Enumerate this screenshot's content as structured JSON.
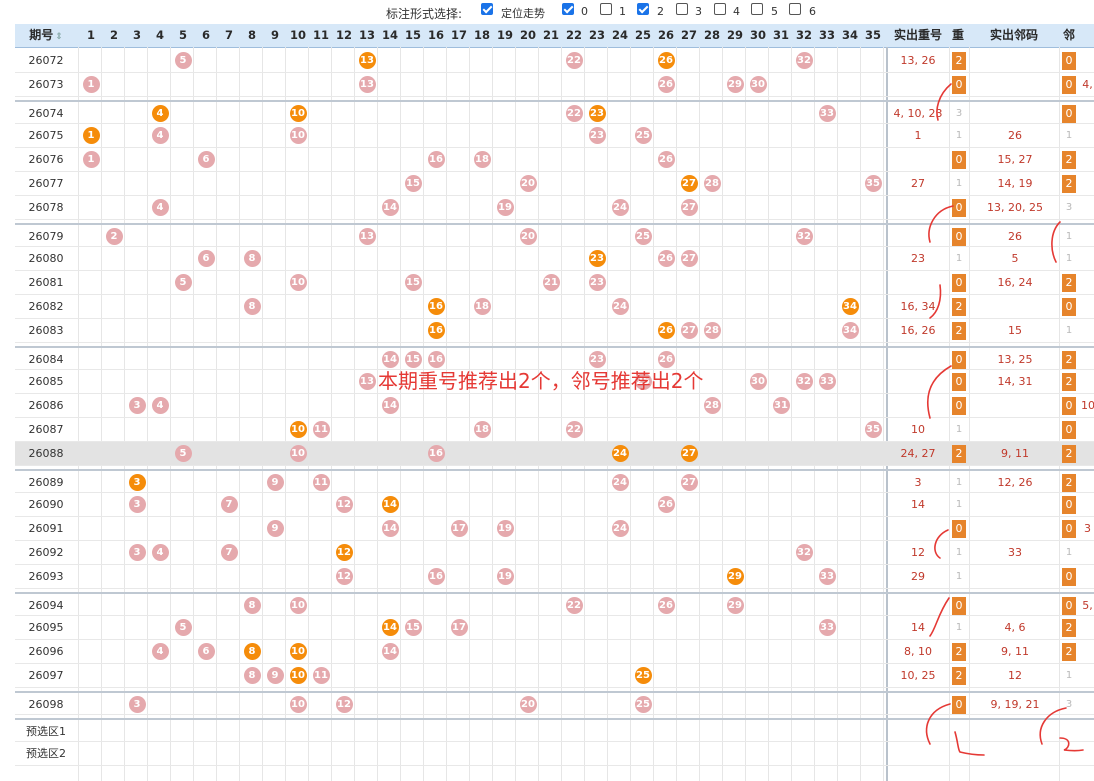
{
  "toolbar": {
    "label": "标注形式选择:",
    "options": [
      {
        "label": "定位走势",
        "checked": true
      },
      {
        "label": "0",
        "checked": true
      },
      {
        "label": "1",
        "checked": false
      },
      {
        "label": "2",
        "checked": true
      },
      {
        "label": "3",
        "checked": false
      },
      {
        "label": "4",
        "checked": false
      },
      {
        "label": "5",
        "checked": false
      },
      {
        "label": "6",
        "checked": false
      }
    ]
  },
  "header": {
    "period": "期号",
    "numbers": [
      "1",
      "2",
      "3",
      "4",
      "5",
      "6",
      "7",
      "8",
      "9",
      "10",
      "11",
      "12",
      "13",
      "14",
      "15",
      "16",
      "17",
      "18",
      "19",
      "20",
      "21",
      "22",
      "23",
      "24",
      "25",
      "26",
      "27",
      "28",
      "29",
      "30",
      "31",
      "32",
      "33",
      "34",
      "35"
    ],
    "repeat": "实出重号",
    "chong": "重",
    "neighbor": "实出邻码",
    "lin": "邻"
  },
  "annotation": "本期重号推荐出2个，邻号推荐出2个",
  "rows": [
    {
      "id": "26072",
      "balls": [
        {
          "n": 5,
          "c": "pink"
        },
        {
          "n": 13,
          "c": "orange"
        },
        {
          "n": 22,
          "c": "pink"
        },
        {
          "n": 26,
          "c": "orange"
        },
        {
          "n": 32,
          "c": "pink"
        }
      ],
      "rep": "13, 26",
      "c": "2",
      "nb": "",
      "l": "0"
    },
    {
      "id": "26073",
      "balls": [
        {
          "n": 1,
          "c": "pink"
        },
        {
          "n": 13,
          "c": "pink"
        },
        {
          "n": 26,
          "c": "pink"
        },
        {
          "n": 29,
          "c": "pink"
        },
        {
          "n": 30,
          "c": "pink"
        }
      ],
      "rep": "",
      "c": "0",
      "nb": "",
      "l": "0",
      "extra": "4,"
    },
    {
      "id": "26074",
      "grp": true,
      "balls": [
        {
          "n": 4,
          "c": "orange"
        },
        {
          "n": 10,
          "c": "orange"
        },
        {
          "n": 22,
          "c": "pink"
        },
        {
          "n": 23,
          "c": "orange"
        },
        {
          "n": 33,
          "c": "pink"
        }
      ],
      "rep": "4, 10, 23",
      "c": "3",
      "nb": "",
      "l": "0"
    },
    {
      "id": "26075",
      "balls": [
        {
          "n": 1,
          "c": "orange"
        },
        {
          "n": 4,
          "c": "pink"
        },
        {
          "n": 10,
          "c": "pink"
        },
        {
          "n": 23,
          "c": "pink"
        },
        {
          "n": 25,
          "c": "pink"
        }
      ],
      "rep": "1",
      "c": "1",
      "nb": "26",
      "l": "1"
    },
    {
      "id": "26076",
      "balls": [
        {
          "n": 1,
          "c": "pink"
        },
        {
          "n": 6,
          "c": "pink"
        },
        {
          "n": 16,
          "c": "pink"
        },
        {
          "n": 18,
          "c": "pink"
        },
        {
          "n": 26,
          "c": "pink"
        }
      ],
      "rep": "",
      "c": "0",
      "nb": "15, 27",
      "l": "2"
    },
    {
      "id": "26077",
      "balls": [
        {
          "n": 15,
          "c": "pink"
        },
        {
          "n": 20,
          "c": "pink"
        },
        {
          "n": 27,
          "c": "orange"
        },
        {
          "n": 28,
          "c": "pink"
        },
        {
          "n": 35,
          "c": "pink"
        }
      ],
      "rep": "27",
      "c": "1",
      "nb": "14, 19",
      "l": "2"
    },
    {
      "id": "26078",
      "balls": [
        {
          "n": 4,
          "c": "pink"
        },
        {
          "n": 14,
          "c": "pink"
        },
        {
          "n": 19,
          "c": "pink"
        },
        {
          "n": 24,
          "c": "pink"
        },
        {
          "n": 27,
          "c": "pink"
        }
      ],
      "rep": "",
      "c": "0",
      "nb": "13, 20, 25",
      "l": "3"
    },
    {
      "id": "26079",
      "grp": true,
      "balls": [
        {
          "n": 2,
          "c": "pink"
        },
        {
          "n": 13,
          "c": "pink"
        },
        {
          "n": 20,
          "c": "pink"
        },
        {
          "n": 25,
          "c": "pink"
        },
        {
          "n": 32,
          "c": "pink"
        }
      ],
      "rep": "",
      "c": "0",
      "nb": "26",
      "l": "1"
    },
    {
      "id": "26080",
      "balls": [
        {
          "n": 6,
          "c": "pink"
        },
        {
          "n": 8,
          "c": "pink"
        },
        {
          "n": 23,
          "c": "orange"
        },
        {
          "n": 26,
          "c": "pink"
        },
        {
          "n": 27,
          "c": "pink"
        }
      ],
      "rep": "23",
      "c": "1",
      "nb": "5",
      "l": "1"
    },
    {
      "id": "26081",
      "balls": [
        {
          "n": 5,
          "c": "pink"
        },
        {
          "n": 10,
          "c": "pink"
        },
        {
          "n": 15,
          "c": "pink"
        },
        {
          "n": 21,
          "c": "pink"
        },
        {
          "n": 23,
          "c": "pink"
        }
      ],
      "rep": "",
      "c": "0",
      "nb": "16, 24",
      "l": "2"
    },
    {
      "id": "26082",
      "balls": [
        {
          "n": 8,
          "c": "pink"
        },
        {
          "n": 16,
          "c": "orange"
        },
        {
          "n": 18,
          "c": "pink"
        },
        {
          "n": 24,
          "c": "pink"
        },
        {
          "n": 34,
          "c": "orange"
        }
      ],
      "rep": "16, 34",
      "c": "2",
      "nb": "",
      "l": "0"
    },
    {
      "id": "26083",
      "balls": [
        {
          "n": 16,
          "c": "orange"
        },
        {
          "n": 26,
          "c": "orange"
        },
        {
          "n": 27,
          "c": "pink"
        },
        {
          "n": 28,
          "c": "pink"
        },
        {
          "n": 34,
          "c": "pink"
        }
      ],
      "rep": "16, 26",
      "c": "2",
      "nb": "15",
      "l": "1"
    },
    {
      "id": "26084",
      "grp": true,
      "balls": [
        {
          "n": 14,
          "c": "pink"
        },
        {
          "n": 15,
          "c": "pink"
        },
        {
          "n": 16,
          "c": "pink"
        },
        {
          "n": 23,
          "c": "pink"
        },
        {
          "n": 26,
          "c": "pink"
        }
      ],
      "rep": "",
      "c": "0",
      "nb": "13, 25",
      "l": "2"
    },
    {
      "id": "26085",
      "balls": [
        {
          "n": 13,
          "c": "pink"
        },
        {
          "n": 25,
          "c": "pink"
        },
        {
          "n": 30,
          "c": "pink"
        },
        {
          "n": 32,
          "c": "pink"
        },
        {
          "n": 33,
          "c": "pink"
        }
      ],
      "rep": "",
      "c": "0",
      "nb": "14, 31",
      "l": "2"
    },
    {
      "id": "26086",
      "balls": [
        {
          "n": 3,
          "c": "pink"
        },
        {
          "n": 4,
          "c": "pink"
        },
        {
          "n": 14,
          "c": "pink"
        },
        {
          "n": 28,
          "c": "pink"
        },
        {
          "n": 31,
          "c": "pink"
        }
      ],
      "rep": "",
      "c": "0",
      "nb": "",
      "l": "0",
      "extra": "10"
    },
    {
      "id": "26087",
      "balls": [
        {
          "n": 10,
          "c": "orange"
        },
        {
          "n": 11,
          "c": "pink"
        },
        {
          "n": 18,
          "c": "pink"
        },
        {
          "n": 22,
          "c": "pink"
        },
        {
          "n": 35,
          "c": "pink"
        }
      ],
      "rep": "10",
      "c": "1",
      "nb": "",
      "l": "0"
    },
    {
      "id": "26088",
      "hl": true,
      "balls": [
        {
          "n": 5,
          "c": "pink"
        },
        {
          "n": 10,
          "c": "pink"
        },
        {
          "n": 16,
          "c": "pink"
        },
        {
          "n": 24,
          "c": "orange"
        },
        {
          "n": 27,
          "c": "orange"
        }
      ],
      "rep": "24, 27",
      "c": "2",
      "nb": "9, 11",
      "l": "2"
    },
    {
      "id": "26089",
      "grp": true,
      "balls": [
        {
          "n": 3,
          "c": "orange"
        },
        {
          "n": 9,
          "c": "pink"
        },
        {
          "n": 11,
          "c": "pink"
        },
        {
          "n": 24,
          "c": "pink"
        },
        {
          "n": 27,
          "c": "pink"
        }
      ],
      "rep": "3",
      "c": "1",
      "nb": "12, 26",
      "l": "2"
    },
    {
      "id": "26090",
      "balls": [
        {
          "n": 3,
          "c": "pink"
        },
        {
          "n": 7,
          "c": "pink"
        },
        {
          "n": 12,
          "c": "pink"
        },
        {
          "n": 14,
          "c": "orange"
        },
        {
          "n": 26,
          "c": "pink"
        }
      ],
      "rep": "14",
      "c": "1",
      "nb": "",
      "l": "0"
    },
    {
      "id": "26091",
      "balls": [
        {
          "n": 9,
          "c": "pink"
        },
        {
          "n": 14,
          "c": "pink"
        },
        {
          "n": 17,
          "c": "pink"
        },
        {
          "n": 19,
          "c": "pink"
        },
        {
          "n": 24,
          "c": "pink"
        }
      ],
      "rep": "",
      "c": "0",
      "nb": "",
      "l": "0",
      "extra": "3"
    },
    {
      "id": "26092",
      "balls": [
        {
          "n": 3,
          "c": "pink"
        },
        {
          "n": 4,
          "c": "pink"
        },
        {
          "n": 7,
          "c": "pink"
        },
        {
          "n": 12,
          "c": "orange"
        },
        {
          "n": 32,
          "c": "pink"
        }
      ],
      "rep": "12",
      "c": "1",
      "nb": "33",
      "l": "1"
    },
    {
      "id": "26093",
      "balls": [
        {
          "n": 12,
          "c": "pink"
        },
        {
          "n": 16,
          "c": "pink"
        },
        {
          "n": 19,
          "c": "pink"
        },
        {
          "n": 29,
          "c": "orange"
        },
        {
          "n": 33,
          "c": "pink"
        }
      ],
      "rep": "29",
      "c": "1",
      "nb": "",
      "l": "0"
    },
    {
      "id": "26094",
      "grp": true,
      "balls": [
        {
          "n": 8,
          "c": "pink"
        },
        {
          "n": 10,
          "c": "pink"
        },
        {
          "n": 22,
          "c": "pink"
        },
        {
          "n": 26,
          "c": "pink"
        },
        {
          "n": 29,
          "c": "pink"
        }
      ],
      "rep": "",
      "c": "0",
      "nb": "",
      "l": "0",
      "extra": "5,"
    },
    {
      "id": "26095",
      "balls": [
        {
          "n": 5,
          "c": "pink"
        },
        {
          "n": 14,
          "c": "orange"
        },
        {
          "n": 15,
          "c": "pink"
        },
        {
          "n": 17,
          "c": "pink"
        },
        {
          "n": 33,
          "c": "pink"
        }
      ],
      "rep": "14",
      "c": "1",
      "nb": "4, 6",
      "l": "2"
    },
    {
      "id": "26096",
      "balls": [
        {
          "n": 4,
          "c": "pink"
        },
        {
          "n": 6,
          "c": "pink"
        },
        {
          "n": 8,
          "c": "orange"
        },
        {
          "n": 10,
          "c": "orange"
        },
        {
          "n": 14,
          "c": "pink"
        }
      ],
      "rep": "8, 10",
      "c": "2",
      "nb": "9, 11",
      "l": "2"
    },
    {
      "id": "26097",
      "balls": [
        {
          "n": 8,
          "c": "pink"
        },
        {
          "n": 9,
          "c": "pink"
        },
        {
          "n": 10,
          "c": "orange"
        },
        {
          "n": 11,
          "c": "pink"
        },
        {
          "n": 25,
          "c": "orange"
        }
      ],
      "rep": "10, 25",
      "c": "2",
      "nb": "12",
      "l": "1"
    },
    {
      "id": "26098",
      "grp": true,
      "balls": [
        {
          "n": 3,
          "c": "pink"
        },
        {
          "n": 10,
          "c": "pink"
        },
        {
          "n": 12,
          "c": "pink"
        },
        {
          "n": 20,
          "c": "pink"
        },
        {
          "n": 25,
          "c": "pink"
        }
      ],
      "rep": "",
      "c": "0",
      "nb": "9, 19, 21",
      "l": "3"
    },
    {
      "id": "预选区1",
      "grp": true,
      "balls": [],
      "rep": "",
      "c": "",
      "nb": "",
      "l": ""
    },
    {
      "id": "预选区2",
      "balls": [],
      "rep": "",
      "c": "",
      "nb": "",
      "l": ""
    }
  ]
}
